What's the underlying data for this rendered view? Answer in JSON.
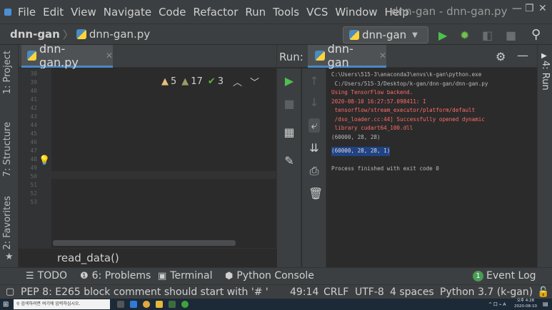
{
  "menubar": {
    "items": [
      "File",
      "Edit",
      "View",
      "Navigate",
      "Code",
      "Refactor",
      "Run",
      "Tools",
      "VCS",
      "Window",
      "Help"
    ],
    "window_title": "dnn-gan - dnn-gan.py"
  },
  "navbar": {
    "project": "dnn-gan",
    "separator": "〉",
    "file": "dnn-gan.py",
    "run_config": "dnn-gan"
  },
  "left_strip": {
    "project": "1: Project",
    "structure": "7: Structure",
    "favorites": "2: Favorites"
  },
  "right_strip": {
    "run": "4: Run"
  },
  "editor": {
    "tab_label": "dnn-gan.py",
    "inspections": {
      "warnings": "5",
      "weak_warnings": "17",
      "typos": "3"
    },
    "line_numbers": [
      "38",
      "39",
      "40",
      "41",
      "42",
      "43",
      "44",
      "45",
      "46",
      "47",
      "48",
      "49",
      "50",
      "51",
      "52",
      "53"
    ],
    "breadcrumb": "read_data()"
  },
  "run": {
    "label": "Run:",
    "tab_label": "dnn-gan",
    "console": [
      "C:\\Users\\515-3\\anaconda3\\envs\\k-gan\\python.exe",
      " C:/Users/515-3/Desktop/k-gan/dnn-gan/dnn-gan.py",
      "Using TensorFlow backend.",
      "2020-08-10 16:27:57.098411: I",
      " tensorflow/stream_executor/platform/default",
      " /dso_loader.cc:44] Successfully opened dynamic",
      " library cudart64_100.dll",
      "(60000, 28, 28)",
      "(60000, 28, 28, 1)",
      "",
      "Process finished with exit code 0"
    ]
  },
  "bottom_tabs": {
    "todo": "TODO",
    "problems": "6: Problems",
    "terminal": "Terminal",
    "python_console": "Python Console",
    "event_log": "Event Log",
    "event_count": "1"
  },
  "status": {
    "message": "PEP 8: E265 block comment should start with '# '",
    "position": "49:14",
    "line_sep": "CRLF",
    "encoding": "UTF-8",
    "indent": "4 spaces",
    "interpreter": "Python 3.7 (k-gan)"
  },
  "taskbar": {
    "search_placeholder": "검색하려면 여기에 입력하십시오.",
    "clock_time": "오후 4:28",
    "clock_date": "2020-08-10",
    "tray": "^ 口 ⌁ A"
  },
  "colors": {
    "run_green": "#4fbf4f",
    "debug_green": "#72c04d",
    "accent_blue": "#4a88c7",
    "error_red": "#ff6b68"
  }
}
